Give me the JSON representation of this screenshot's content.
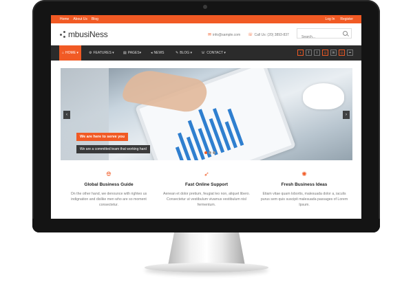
{
  "topbar": {
    "links": [
      "Home",
      "About Us",
      "Blog"
    ],
    "login": "Log In",
    "register": "Register"
  },
  "header": {
    "logo": "mbusiNess",
    "email": "info@sample.com",
    "phone": "Call Us: (20) 3893-837",
    "search_placeholder": "Search..."
  },
  "nav": {
    "items": [
      "HOME",
      "FEATURES",
      "PAGES",
      "NEWS",
      "BLOG",
      "CONTACT"
    ],
    "social_icons": [
      "rss-icon",
      "facebook-icon",
      "twitter-icon",
      "google-plus-icon",
      "linkedin-icon",
      "dribbble-icon",
      "flickr-icon"
    ]
  },
  "slider": {
    "caption_title": "We are here to serve you",
    "caption_text": "We are a committed team that working hard",
    "slide_count": 3,
    "active_slide": 1
  },
  "features": [
    {
      "icon": "globe-icon",
      "title": "Global Business Guide",
      "text": "On the other hand, we denounce with righteo us indignation and dislike men who are so moment consectetur."
    },
    {
      "icon": "rocket-icon",
      "title": "Fast Online Support",
      "text": "Aenean et dolor pretium, feugiat leo non, aliquet libero. Consectetur ut vestibulum vivamus vestibulum nisl fermentum."
    },
    {
      "icon": "lightbulb-icon",
      "title": "Fresh Business Ideas",
      "text": "Etiam vitae quam lobortis, malesuada dolor a, iaculis purus sem quis suscipit malesuada passages of Lorem Ipsum."
    }
  ],
  "colors": {
    "accent": "#f15a24",
    "nav_bg": "#2b2b2b",
    "bezel": "#141414"
  }
}
